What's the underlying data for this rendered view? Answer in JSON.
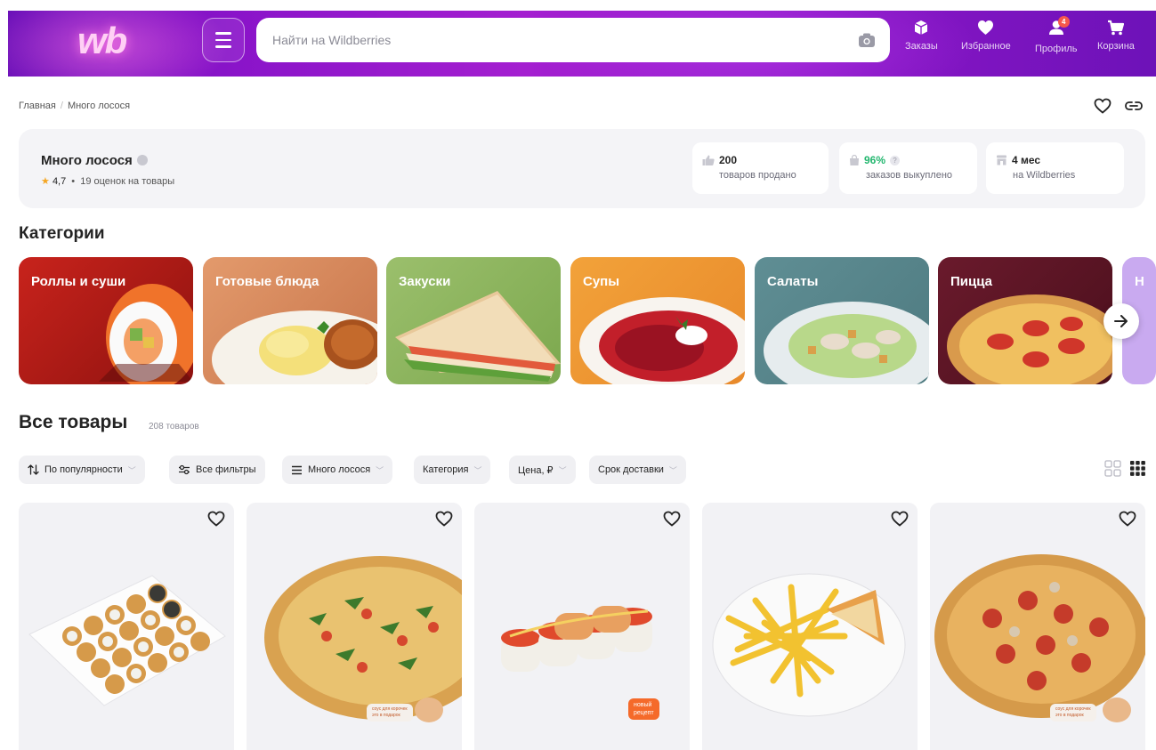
{
  "header": {
    "logo": "wb",
    "search_placeholder": "Найти на Wildberries",
    "nav": [
      {
        "label": "Заказы",
        "icon": "box-icon"
      },
      {
        "label": "Избранное",
        "icon": "heart-icon"
      },
      {
        "label": "Профиль",
        "icon": "profile-icon",
        "badge": "4"
      },
      {
        "label": "Корзина",
        "icon": "cart-icon"
      }
    ]
  },
  "breadcrumb": {
    "home": "Главная",
    "sep": "/",
    "current": "Много лосося"
  },
  "seller": {
    "name": "Много лосося",
    "rating": "4,7",
    "dot": "•",
    "reviews": "19 оценок на товары",
    "stats": [
      {
        "value": "200",
        "label": "товаров продано"
      },
      {
        "value": "96%",
        "help": "?",
        "label": "заказов выкуплено"
      },
      {
        "value": "4 мес",
        "label": "на Wildberries"
      }
    ]
  },
  "categories": {
    "title": "Категории",
    "items": [
      "Роллы и суши",
      "Готовые блюда",
      "Закуски",
      "Супы",
      "Салаты",
      "Пицца",
      "Н"
    ]
  },
  "goods": {
    "title": "Все товары",
    "count": "208 товаров",
    "filters": [
      "По популярности",
      "Все фильтры",
      "Много лосося",
      "Категория",
      "Цена, ₽",
      "Срок доставки"
    ]
  },
  "products": [
    {
      "name": "sushi-set"
    },
    {
      "name": "pizza-greens",
      "promo": [
        "соус для корочек",
        "это в подарок"
      ]
    },
    {
      "name": "rolls",
      "promo": [
        "новый",
        "рецепт"
      ]
    },
    {
      "name": "fries"
    },
    {
      "name": "pizza-pepperoni",
      "promo": [
        "соус для корочек",
        "это в подарок"
      ]
    }
  ],
  "colors": {
    "brand": "#8a14c9",
    "accent_green": "#22b66e",
    "badge": "#f5574c"
  }
}
